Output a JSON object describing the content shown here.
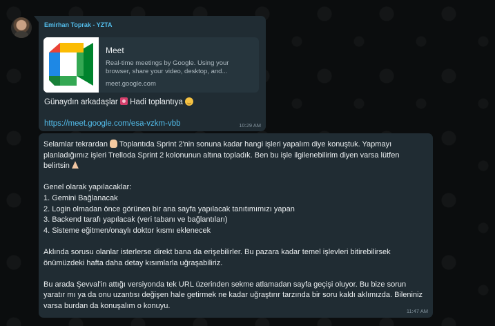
{
  "chat": {
    "message1": {
      "sender": "Emirhan Toprak - YZTA",
      "preview": {
        "title": "Meet",
        "description": "Real-time meetings by Google. Using your browser, share your video, desktop, and...",
        "domain": "meet.google.com"
      },
      "greeting_text": "Günaydın arkadaşlar",
      "greeting_tail": "Hadi toplantıya",
      "link": "https://meet.google.com/esa-vzkm-vbb",
      "time": "10:29 AM"
    },
    "message2": {
      "intro_a": "Selamlar tekrardan",
      "intro_b": "Toplantıda Sprint 2'nin sonuna kadar hangi işleri yapalım diye konuştuk. Yapmayı planladığımız işleri Trelloda Sprint 2 kolonunun altına topladık. Ben bu işle ilgilenebilirim diyen varsa lütfen belirtsin",
      "list_title": "Genel olarak yapılacaklar:",
      "items": [
        "1. Gemini Bağlanacak",
        "2. Login olmadan önce görünen bir ana sayfa yapılacak tanıtımımızı yapan",
        "3. Backend tarafı yapılacak (veri tabanı ve bağlantıları)",
        "4. Sisteme eğitmen/onaylı doktor kısmı eklenecek"
      ],
      "para2": "Aklında sorusu olanlar isterlerse direkt bana da erişebilirler. Bu pazara kadar temel işlevleri bitirebilirsek önümüzdeki hafta daha detay kısımlarla uğraşabiliriz.",
      "para3": "Bu arada Şevval'in attığı versiyonda tek URL üzerinden sekme atlamadan sayfa geçişi oluyor. Bu bize sorun yaratır mı ya da onu uzantısı değişen hale getirmek ne kadar uğraştırır tarzında bir soru kaldı aklımızda. Bileniniz varsa burdan da konuşalım o konuyu.",
      "time": "11:47 AM"
    }
  },
  "colors": {
    "background": "#0b0d0e",
    "bubble": "#202c33",
    "sender": "#53bdeb",
    "link": "#53bdeb",
    "meta": "#8696a0"
  }
}
